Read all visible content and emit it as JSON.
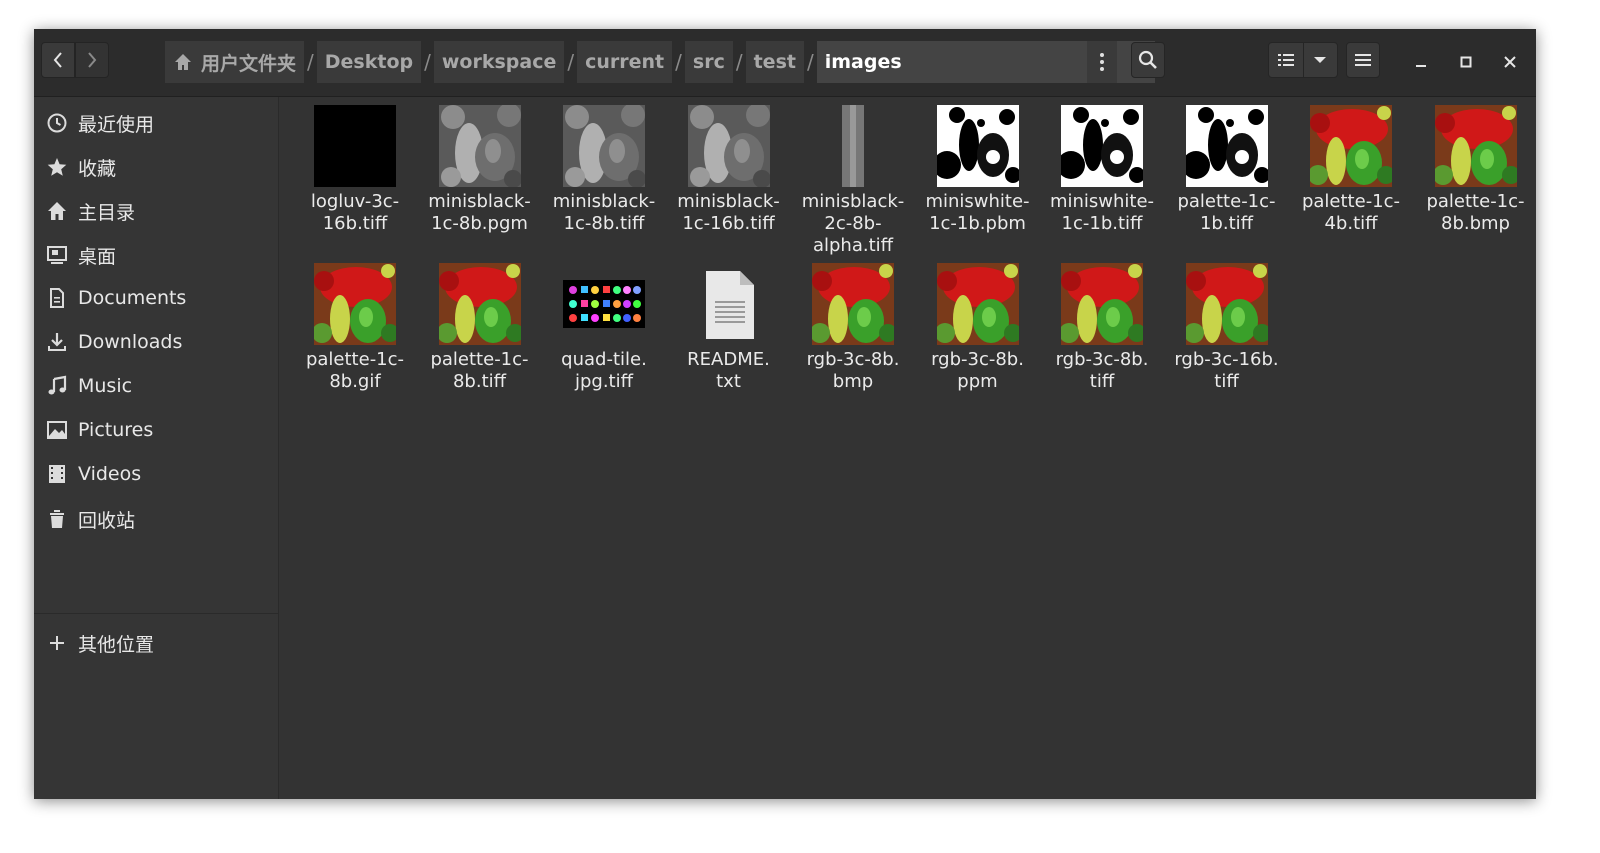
{
  "headerbar": {
    "breadcrumbs": [
      "用户文件夹",
      "Desktop",
      "workspace",
      "current",
      "src",
      "test",
      "images"
    ],
    "separator": "/"
  },
  "sidebar": {
    "items": [
      {
        "label": "最近使用",
        "icon": "clock-icon"
      },
      {
        "label": "收藏",
        "icon": "star-icon"
      },
      {
        "label": "主目录",
        "icon": "home-icon"
      },
      {
        "label": "桌面",
        "icon": "desktop-icon"
      },
      {
        "label": "Documents",
        "icon": "document-icon"
      },
      {
        "label": "Downloads",
        "icon": "download-icon"
      },
      {
        "label": "Music",
        "icon": "music-icon"
      },
      {
        "label": "Pictures",
        "icon": "picture-icon"
      },
      {
        "label": "Videos",
        "icon": "film-icon"
      },
      {
        "label": "回收站",
        "icon": "trash-icon"
      }
    ],
    "other_locations": {
      "label": "其他位置",
      "icon": "plus-icon"
    }
  },
  "files": [
    {
      "name": "logluv-3c-\n16b.tiff",
      "thumb": "black"
    },
    {
      "name": "minisblack-\n1c-8b.pgm",
      "thumb": "gray-peppers"
    },
    {
      "name": "minisblack-\n1c-8b.tiff",
      "thumb": "gray-peppers"
    },
    {
      "name": "minisblack-\n1c-16b.tiff",
      "thumb": "gray-peppers"
    },
    {
      "name": "minisblack-\n2c-8b-\nalpha.tiff",
      "thumb": "gray-strip"
    },
    {
      "name": "miniswhite-\n1c-1b.pbm",
      "thumb": "bw-peppers"
    },
    {
      "name": "miniswhite-\n1c-1b.tiff",
      "thumb": "bw-peppers"
    },
    {
      "name": "palette-1c-\n1b.tiff",
      "thumb": "bw-peppers"
    },
    {
      "name": "palette-1c-\n4b.tiff",
      "thumb": "color-peppers"
    },
    {
      "name": "palette-1c-\n8b.bmp",
      "thumb": "color-peppers"
    },
    {
      "name": "palette-1c-\n8b.gif",
      "thumb": "color-peppers"
    },
    {
      "name": "palette-1c-\n8b.tiff",
      "thumb": "color-peppers"
    },
    {
      "name": "quad-tile.\njpg.tiff",
      "thumb": "quad-tile"
    },
    {
      "name": "README.\ntxt",
      "thumb": "text-file"
    },
    {
      "name": "rgb-3c-8b.\nbmp",
      "thumb": "color-peppers"
    },
    {
      "name": "rgb-3c-8b.\nppm",
      "thumb": "color-peppers"
    },
    {
      "name": "rgb-3c-8b.\ntiff",
      "thumb": "color-peppers"
    },
    {
      "name": "rgb-3c-16b.\ntiff",
      "thumb": "color-peppers"
    }
  ],
  "colors": {
    "window_bg": "#333333",
    "headerbar_bg": "#2c2c2c",
    "sidebar_bg": "#353535",
    "text": "#e8e8e8"
  }
}
